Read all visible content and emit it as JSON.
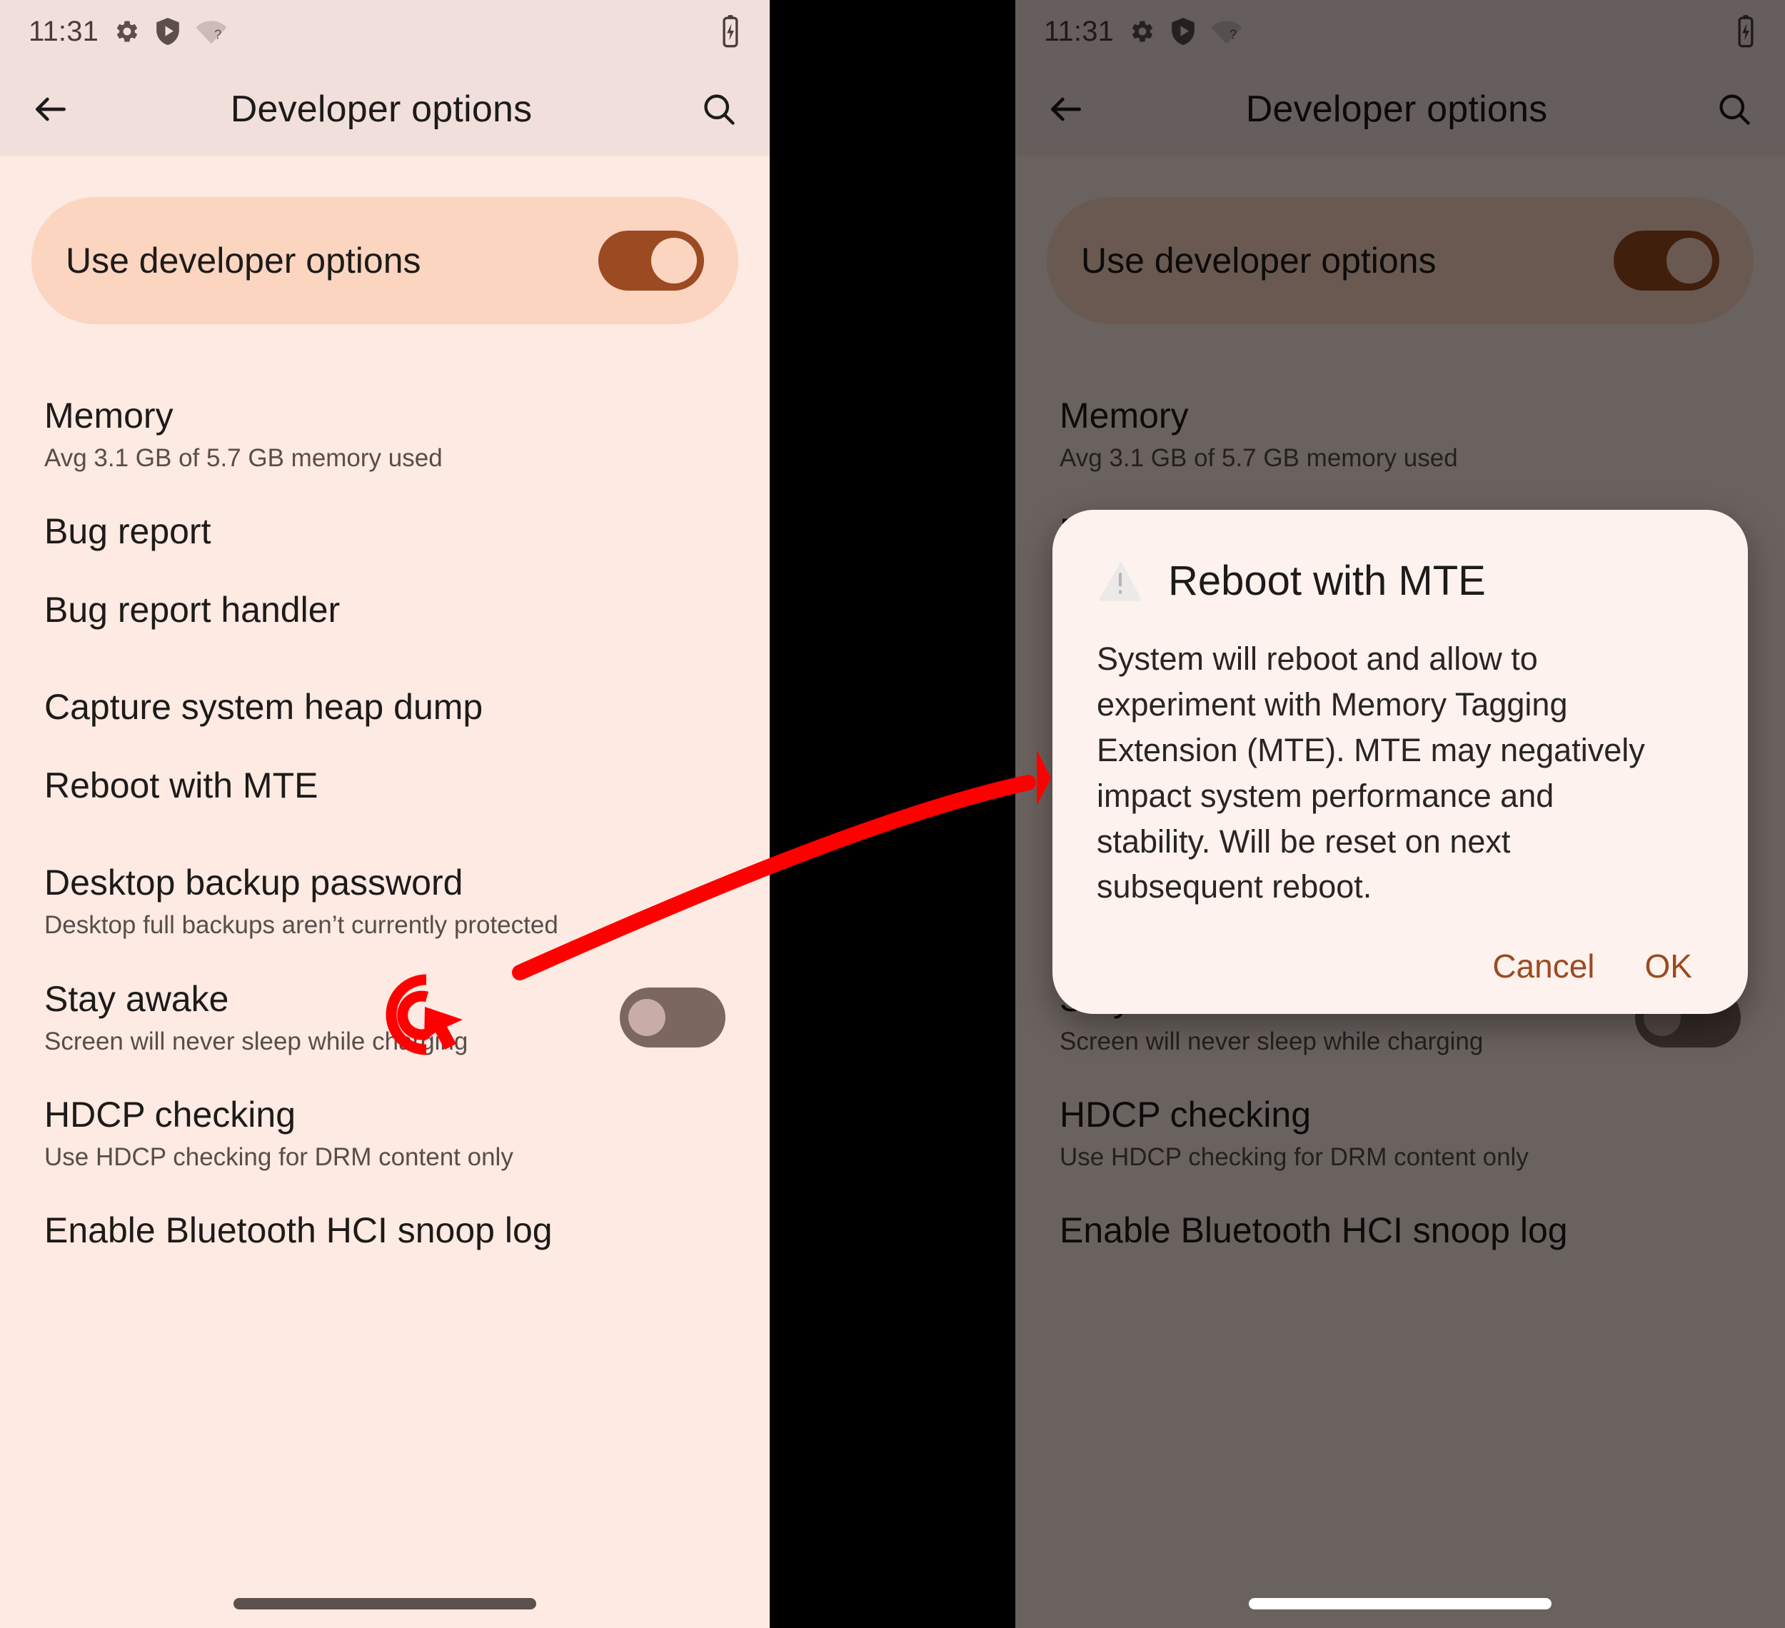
{
  "statusbar": {
    "time": "11:31",
    "icons": [
      "gear-icon",
      "shield-play-icon",
      "wifi-question-icon"
    ],
    "battery": "battery-charging-icon"
  },
  "appbar": {
    "back": "back-arrow-icon",
    "title": "Developer options",
    "search": "search-icon"
  },
  "master_switch": {
    "label": "Use developer options",
    "state": "on"
  },
  "list": [
    {
      "title": "Memory",
      "sub": "Avg 3.1 GB of 5.7 GB memory used"
    },
    {
      "title": "Bug report",
      "sub": ""
    },
    {
      "title": "Bug report handler",
      "sub": ""
    },
    {
      "title": "Capture system heap dump",
      "sub": ""
    },
    {
      "title": "Reboot with MTE",
      "sub": ""
    },
    {
      "title": "Desktop backup password",
      "sub": "Desktop full backups aren’t currently protected"
    },
    {
      "title": "Stay awake",
      "sub": "Screen will never sleep while charging",
      "switch": "off"
    },
    {
      "title": "HDCP checking",
      "sub": "Use HDCP checking for DRM content only"
    },
    {
      "title": "Enable Bluetooth HCI snoop log",
      "sub": ""
    }
  ],
  "dialog": {
    "icon": "warning-triangle-icon",
    "title": "Reboot with MTE",
    "body": "System will reboot and allow to experiment with Memory Tagging Extension (MTE). MTE may negatively impact system performance and stability. Will be reset on next subsequent reboot.",
    "cancel": "Cancel",
    "ok": "OK"
  },
  "annotation": {
    "click_target": "Reboot with MTE",
    "color": "#ff0000"
  },
  "colors": {
    "accent": "#9b4a21",
    "surface": "#fdeae2",
    "appbar": "#f0dfdb",
    "card": "#fbd5c0",
    "dialog": "#fdf2ee",
    "scrim": "rgba(0,0,0,0.58)",
    "annotation": "#ff0000"
  }
}
